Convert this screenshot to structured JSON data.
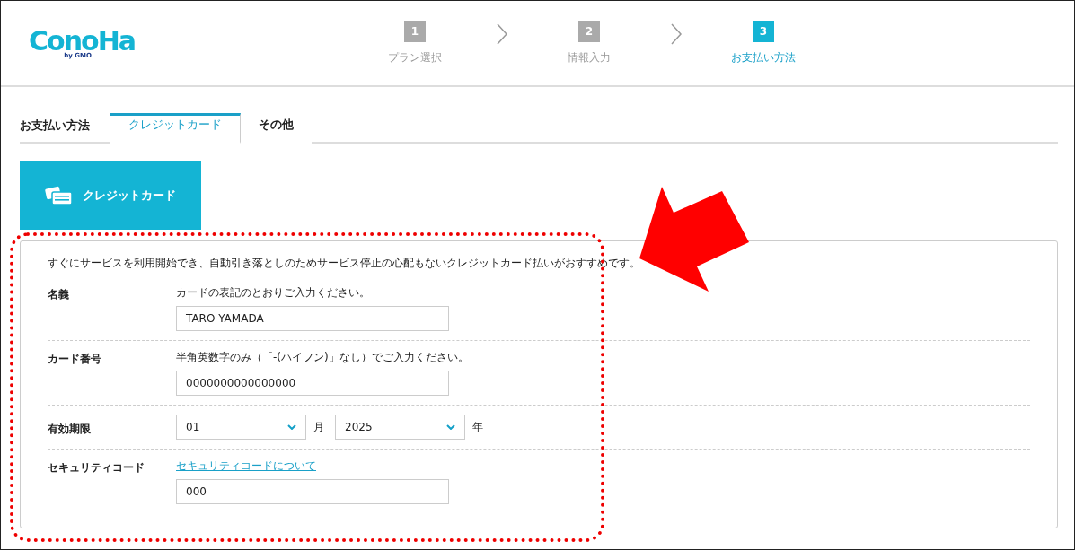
{
  "header": {
    "logo": {
      "name": "ConoHa",
      "byline": "by GMO"
    },
    "steps": [
      {
        "number": "1",
        "label": "プラン選択",
        "selected": false
      },
      {
        "number": "2",
        "label": "情報入力",
        "selected": false
      },
      {
        "number": "3",
        "label": "お支払い方法",
        "selected": true
      }
    ]
  },
  "tabs": {
    "title": "お支払い方法",
    "items": [
      {
        "label": "クレジットカード",
        "selected": true
      },
      {
        "label": "その他",
        "selected": false
      }
    ]
  },
  "method_button": {
    "label": "クレジットカード",
    "selected": true
  },
  "form": {
    "intro": "すぐにサービスを利用開始でき、自動引き落としのためサービス停止の心配もないクレジットカード払いがおすすめです。",
    "rows": [
      {
        "kind": "text",
        "label": "名義",
        "hint": "カードの表記のとおりご入力ください。",
        "value": "TARO YAMADA"
      },
      {
        "kind": "text",
        "label": "カード番号",
        "hint": "半角英数字のみ（「-(ハイフン)」なし）でご入力ください。",
        "value": "0000000000000000"
      },
      {
        "kind": "expiry",
        "label": "有効期限",
        "month": "01",
        "month_unit": "月",
        "year": "2025",
        "year_unit": "年"
      },
      {
        "kind": "text",
        "label": "セキュリティコード",
        "link": "セキュリティコードについて",
        "value": "000"
      }
    ]
  }
}
